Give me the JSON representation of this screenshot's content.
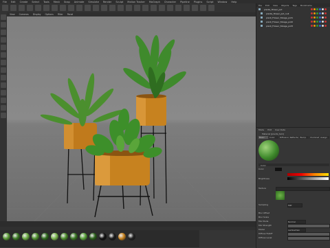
{
  "menubar": [
    "File",
    "Edit",
    "Create",
    "Select",
    "Tools",
    "Mesh",
    "Snap",
    "Animate",
    "Simulate",
    "Render",
    "Sculpt",
    "Motion Tracker",
    "MoGraph",
    "Character",
    "Pipeline",
    "Plugins",
    "Script",
    "Window",
    "Help"
  ],
  "viewport": {
    "menu": [
      "View",
      "Cameras",
      "Display",
      "Options",
      "Filter",
      "Panel"
    ]
  },
  "objects": {
    "tabs": [
      "File",
      "Edit",
      "View",
      "Objects",
      "Tags",
      "Bookmarks"
    ],
    "rows": [
      {
        "name": "plants_flower_pot"
      },
      {
        "name": "plants_flower_pot_null"
      },
      {
        "name": "plant_Flower_foliage_pot1"
      },
      {
        "name": "plant_Flower_foliage_pot2"
      },
      {
        "name": "plant_Flower_foliage_pot3"
      }
    ]
  },
  "attributes": {
    "tabs": [
      "Mode",
      "Edit",
      "User Data"
    ],
    "material_name": "Material [plants_tam]",
    "material_tabs": [
      "Basic",
      "Color",
      "Diffusion",
      "Reflectance",
      "Bump",
      "Illumination",
      "Assign"
    ],
    "section_color": "Color",
    "labels": [
      "Color",
      "Brightness",
      "Texture",
      "Sampling",
      "Blur Offset",
      "Blur Scale",
      "Mix Mode",
      "Mix Strength",
      "Model",
      "Diffuse Falloff",
      "Diffuse Level"
    ],
    "sampling_value": "MIP",
    "mix_mode_value": "Normal",
    "model_value": "Lambertian"
  },
  "colors": {
    "accent": "#e0a03a",
    "pot": "#c7821f",
    "leaf": "#3f8a2c"
  }
}
